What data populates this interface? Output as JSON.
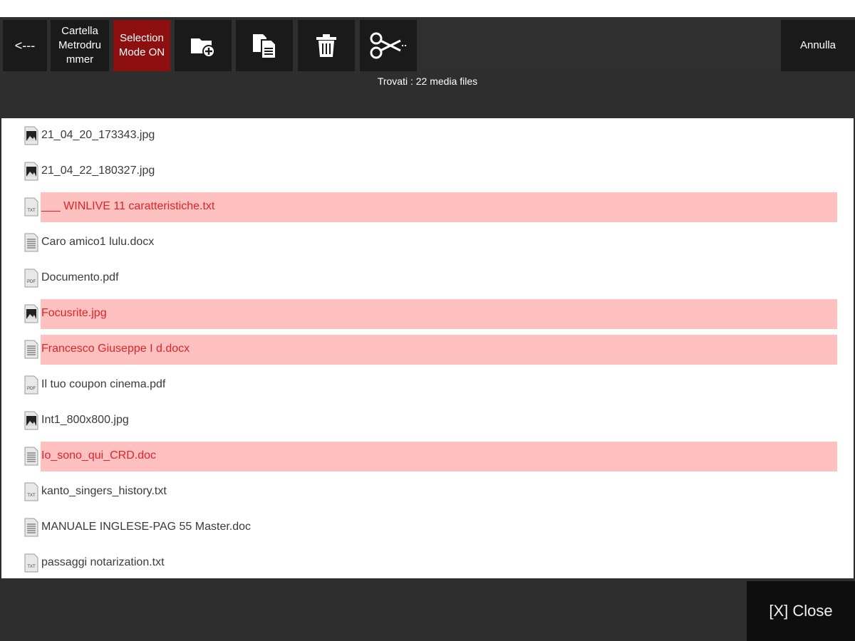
{
  "toolbar": {
    "back_label": "<---",
    "folder_label": "Cartella\nMetrodru\nmmer",
    "selection_label": "Selection\nMode ON",
    "annulla_label": "Annulla",
    "icons": [
      "new-folder-icon",
      "copy-icon",
      "trash-icon",
      "scissors-icon"
    ]
  },
  "status": {
    "text": "Trovati : 22 media files"
  },
  "colors": {
    "selection_mode_bg": "#8e0f0f",
    "selected_row_bg": "#ffc0c0",
    "selected_text": "#e0242a"
  },
  "files": [
    {
      "name": "21_04_20_173343.jpg",
      "type": "image",
      "selected": false
    },
    {
      "name": "21_04_22_180327.jpg",
      "type": "image",
      "selected": false
    },
    {
      "name": "___ WINLIVE 11 caratteristiche.txt",
      "type": "txt",
      "selected": true
    },
    {
      "name": "Caro amico1 lulu.docx",
      "type": "doc",
      "selected": false
    },
    {
      "name": "Documento.pdf",
      "type": "pdf",
      "selected": false
    },
    {
      "name": "Focusrite.jpg",
      "type": "image",
      "selected": true
    },
    {
      "name": "Francesco Giuseppe I d.docx",
      "type": "doc",
      "selected": true
    },
    {
      "name": "Il tuo coupon cinema.pdf",
      "type": "pdf",
      "selected": false
    },
    {
      "name": "Int1_800x800.jpg",
      "type": "image",
      "selected": false
    },
    {
      "name": "Io_sono_qui_CRD.doc",
      "type": "doc",
      "selected": true
    },
    {
      "name": "kanto_singers_history.txt",
      "type": "txt",
      "selected": false
    },
    {
      "name": "MANUALE INGLESE-PAG 55 Master.doc",
      "type": "doc",
      "selected": false
    },
    {
      "name": "passaggi notarization.txt",
      "type": "txt",
      "selected": false
    }
  ],
  "footer": {
    "close_label": "[X] Close"
  }
}
